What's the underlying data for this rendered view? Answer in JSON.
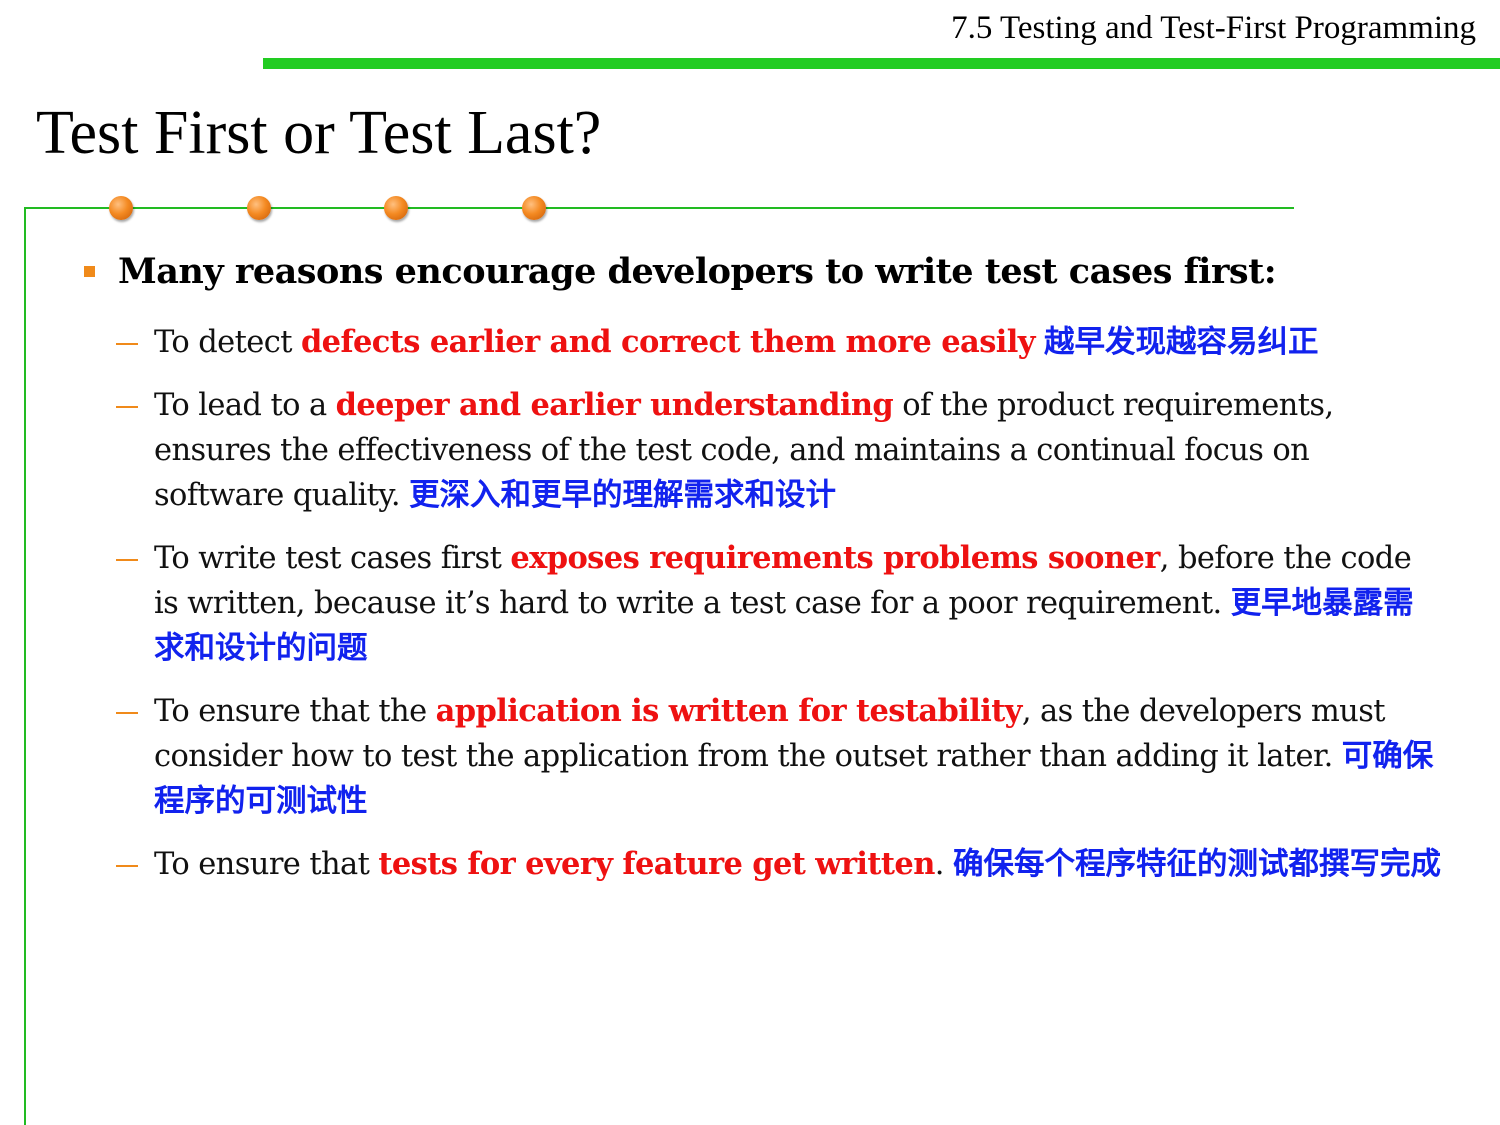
{
  "header": {
    "section_title": "7.5 Testing and Test-First Programming"
  },
  "slide": {
    "title": "Test First or Test Last?",
    "main_bullet": "Many reasons encourage developers to write test cases first:",
    "items": [
      {
        "pre": "To detect ",
        "highlight": "defects earlier and correct them more easily",
        "post": " ",
        "chinese": "越早发现越容易纠正"
      },
      {
        "pre": "To lead to a ",
        "highlight": "deeper and earlier understanding",
        "post": " of the product requirements, ensures the effectiveness of the test code, and maintains a continual focus on software quality. ",
        "chinese": "更深入和更早的理解需求和设计"
      },
      {
        "pre": "To write test cases first ",
        "highlight": "exposes requirements problems sooner",
        "post": ", before the code is written, because it’s hard to write a test case for a poor requirement. ",
        "chinese": "更早地暴露需求和设计的问题"
      },
      {
        "pre": "To ensure that the ",
        "highlight": "application is written for testability",
        "post": ", as the developers must consider how to test the application from the outset rather than adding it later. ",
        "chinese": "可确保程序的可测试性"
      },
      {
        "pre": "To ensure that ",
        "highlight": "tests for every feature get written",
        "post": ". ",
        "chinese": "确保每个程序特征的测试都撰写完成"
      }
    ]
  },
  "colors": {
    "accent_green": "#22cc22",
    "bullet_orange": "#f08a1a",
    "highlight_red": "#ee1111",
    "chinese_blue": "#1122ee"
  }
}
